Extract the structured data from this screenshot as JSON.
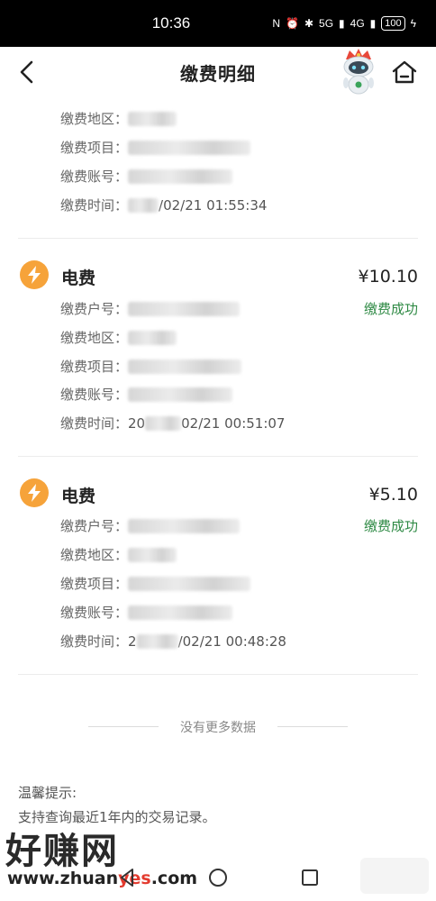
{
  "status_bar": {
    "time": "10:36",
    "net_5g": "5G",
    "net_4g": "4G",
    "battery": "100"
  },
  "nav": {
    "title": "缴费明细"
  },
  "top_partial": {
    "rows": [
      {
        "label": "缴费地区：",
        "value": ""
      },
      {
        "label": "缴费项目：",
        "value": ""
      },
      {
        "label": "缴费账号：",
        "value": ""
      },
      {
        "label": "缴费时间：",
        "value": "/02/21 01:55:34"
      }
    ]
  },
  "records": [
    {
      "title": "电费",
      "amount": "¥10.10",
      "status": "缴费成功",
      "rows": [
        {
          "label": "缴费户号：",
          "value": ""
        },
        {
          "label": "缴费地区：",
          "value": ""
        },
        {
          "label": "缴费项目：",
          "value": ""
        },
        {
          "label": "缴费账号：",
          "value": ""
        },
        {
          "label": "缴费时间：",
          "value_prefix": "20",
          "value": "02/21 00:51:07"
        }
      ]
    },
    {
      "title": "电费",
      "amount": "¥5.10",
      "status": "缴费成功",
      "rows": [
        {
          "label": "缴费户号：",
          "value": ""
        },
        {
          "label": "缴费地区：",
          "value": ""
        },
        {
          "label": "缴费项目：",
          "value": ""
        },
        {
          "label": "缴费账号：",
          "value": ""
        },
        {
          "label": "缴费时间：",
          "value_prefix": "2",
          "value": "/02/21 00:48:28"
        }
      ]
    }
  ],
  "no_more": "没有更多数据",
  "tips": {
    "title": "温馨提示:",
    "body": "支持查询最近1年内的交易记录。"
  },
  "watermark": {
    "brand": "好赚网",
    "url_prefix": "www.zhuan",
    "url_accent": "yes",
    "url_suffix": ".com"
  },
  "colors": {
    "accent_green": "#2f8a45",
    "bolt_orange": "#f6a33a"
  },
  "icons": {
    "back": "chevron-left-icon",
    "home": "home-icon",
    "bolt": "lightning-icon"
  }
}
